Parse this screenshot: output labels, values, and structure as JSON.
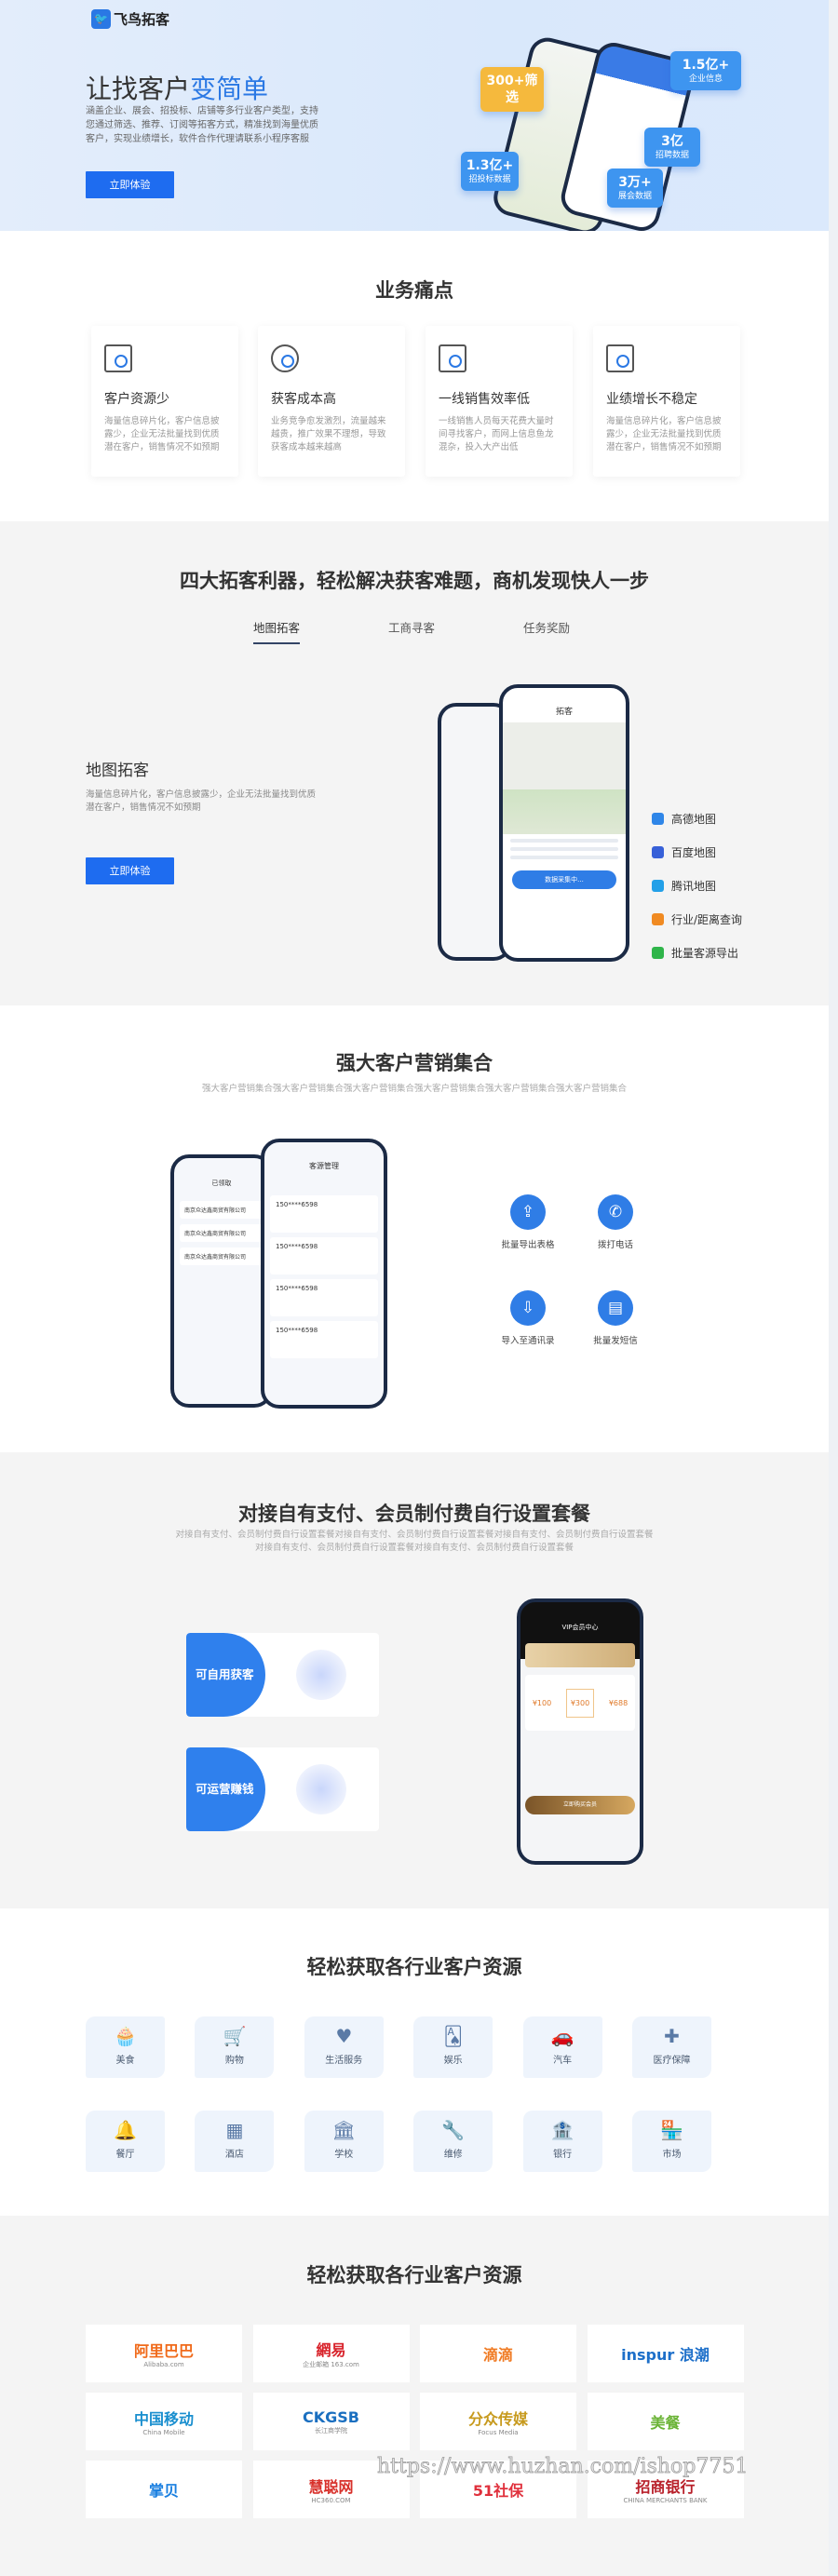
{
  "hero": {
    "brand": "飞鸟拓客",
    "title_a": "让找客户",
    "title_b": "变简单",
    "desc": "涵盖企业、展会、招投标、店铺等多行业客户类型，支持您通过筛选、推荐、订阅等拓客方式，精准找到海量优质客户，实现业绩增长，软件合作代理请联系小程序客服",
    "cta": "立即体验",
    "stats": [
      {
        "v": "300+筛选",
        "l": ""
      },
      {
        "v": "1.5亿+",
        "l": "企业信息"
      },
      {
        "v": "3亿",
        "l": "招聘数据"
      },
      {
        "v": "1.3亿+",
        "l": "招投标数据"
      },
      {
        "v": "3万+",
        "l": "展会数据"
      }
    ]
  },
  "pain": {
    "title": "业务痛点",
    "cards": [
      {
        "title": "客户资源少",
        "desc": "海量信息碎片化，客户信息披露少，企业无法批量找到优质潜在客户，销售情况不如预期"
      },
      {
        "title": "获客成本高",
        "desc": "业务竞争愈发激烈，流量越来越贵，推广效果不理想，导致获客成本越来越高"
      },
      {
        "title": "一线销售效率低",
        "desc": "一线销售人员每天花费大量时间寻找客户，而网上信息鱼龙混杂，投入大产出低"
      },
      {
        "title": "业绩增长不稳定",
        "desc": "海量信息碎片化，客户信息披露少，企业无法批量找到优质潜在客户，销售情况不如预期"
      }
    ]
  },
  "tools": {
    "title": "四大拓客利器，轻松解决获客难题，商机发现快人一步",
    "tabs": [
      "地图拓客",
      "工商寻客",
      "任务奖励"
    ],
    "active_tab": 0,
    "feature_title": "地图拓客",
    "feature_desc": "海量信息碎片化，客户信息披露少，企业无法批量找到优质潜在客户，销售情况不如预期",
    "cta": "立即体验",
    "phone_title": "拓客",
    "phone_button": "数据采集中...",
    "sources": [
      {
        "label": "高德地图",
        "color": "#2f86e8"
      },
      {
        "label": "百度地图",
        "color": "#3760d8"
      },
      {
        "label": "腾讯地图",
        "color": "#23a0e8"
      },
      {
        "label": "行业/距离查询",
        "color": "#f08a22"
      },
      {
        "label": "批量客源导出",
        "color": "#2fb54a"
      }
    ]
  },
  "marketing": {
    "title": "强大客户营销集合",
    "subtitle": "强大客户营销集合强大客户营销集合强大客户营销集合强大客户营销集合强大客户营销集合强大客户营销集合",
    "phone_left_title": "已领取",
    "company": "南京众达鑫商贸有限公司",
    "phone_right_title": "客源管理",
    "phone_number": "150****6598",
    "actions": [
      {
        "label": "批量导出表格",
        "icon": "upload-icon"
      },
      {
        "label": "拨打电话",
        "icon": "phone-icon"
      },
      {
        "label": "导入至通讯录",
        "icon": "download-icon"
      },
      {
        "label": "批量发短信",
        "icon": "sms-icon"
      }
    ]
  },
  "pay": {
    "title": "对接自有支付、会员制付费自行设置套餐",
    "subtitle_1": "对接自有支付、会员制付费自行设置套餐对接自有支付、会员制付费自行设置套餐对接自有支付、会员制付费自行设置套餐",
    "subtitle_2": "对接自有支付、会员制付费自行设置套餐对接自有支付、会员制付费自行设置套餐",
    "cards": [
      "可自用获客",
      "可运营赚钱"
    ],
    "phone_title": "VIP会员中心",
    "plans": [
      "¥100",
      "¥300",
      "¥688"
    ],
    "phone_button": "立即购买会员"
  },
  "industries": {
    "title": "轻松获取各行业客户资源",
    "items": [
      {
        "label": "美食",
        "glyph": "🧁"
      },
      {
        "label": "购物",
        "glyph": "🛒"
      },
      {
        "label": "生活服务",
        "glyph": "♥"
      },
      {
        "label": "娱乐",
        "glyph": "🂡"
      },
      {
        "label": "汽车",
        "glyph": "🚗"
      },
      {
        "label": "医疗保障",
        "glyph": "✚"
      },
      {
        "label": "餐厅",
        "glyph": "🔔"
      },
      {
        "label": "酒店",
        "glyph": "▦"
      },
      {
        "label": "学校",
        "glyph": "🏛"
      },
      {
        "label": "维修",
        "glyph": "🔧"
      },
      {
        "label": "银行",
        "glyph": "🏦"
      },
      {
        "label": "市场",
        "glyph": "🏪"
      }
    ],
    "icon_color": "#5a7aa6"
  },
  "logos": {
    "title": "轻松获取各行业客户资源",
    "items": [
      {
        "name": "阿里巴巴",
        "sub": "Alibaba.com",
        "color": "#f06a1a"
      },
      {
        "name": "網易",
        "sub": "企业邮箱 163.com",
        "color": "#d8222a"
      },
      {
        "name": "滴滴",
        "sub": "",
        "color": "#f07a22"
      },
      {
        "name": "inspur 浪潮",
        "sub": "",
        "color": "#1d6fc9"
      },
      {
        "name": "中国移动",
        "sub": "China Mobile",
        "color": "#1a8fcf"
      },
      {
        "name": "CKGSB",
        "sub": "长江商学院",
        "color": "#1a6fc0"
      },
      {
        "name": "分众传媒",
        "sub": "Focus Media",
        "color": "#c79a1d"
      },
      {
        "name": "美餐",
        "sub": "",
        "color": "#6bb437"
      },
      {
        "name": "掌贝",
        "sub": "",
        "color": "#1a7fe0"
      },
      {
        "name": "慧聪网",
        "sub": "HC360.COM",
        "color": "#d8302a"
      },
      {
        "name": "51社保",
        "sub": "",
        "color": "#e0303c"
      },
      {
        "name": "招商银行",
        "sub": "CHINA MERCHANTS BANK",
        "color": "#b8202a"
      }
    ]
  },
  "watermark": "https://www.huzhan.com/ishop7751",
  "colors": {
    "accent": "#1e6cf0"
  }
}
